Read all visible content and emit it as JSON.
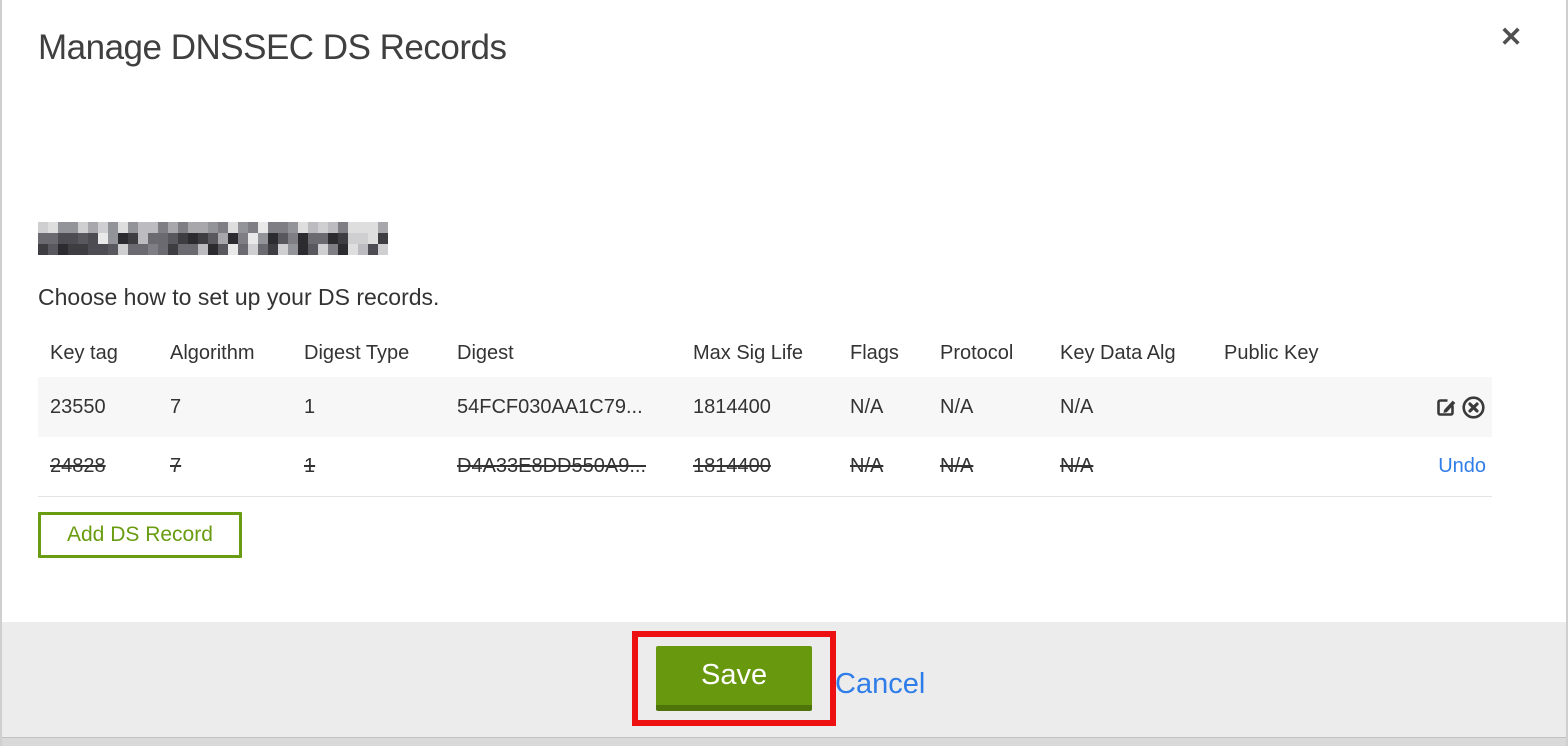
{
  "dialog": {
    "title": "Manage DNSSEC DS Records",
    "close_icon": "close-icon",
    "close_glyph": "✕",
    "instruction": "Choose how to set up your DS records.",
    "table": {
      "columns": [
        "Key tag",
        "Algorithm",
        "Digest Type",
        "Digest",
        "Max Sig Life",
        "Flags",
        "Protocol",
        "Key Data Alg",
        "Public Key"
      ],
      "rows": [
        {
          "key_tag": "23550",
          "algorithm": "7",
          "digest_type": "1",
          "digest": "54FCF030AA1C79...",
          "max_sig_life": "1814400",
          "flags": "N/A",
          "protocol": "N/A",
          "key_data_alg": "N/A",
          "public_key": "",
          "state": "normal",
          "actions": [
            "edit-icon",
            "delete-icon"
          ]
        },
        {
          "key_tag": "24828",
          "algorithm": "7",
          "digest_type": "1",
          "digest": "D4A33E8DD550A9...",
          "max_sig_life": "1814400",
          "flags": "N/A",
          "protocol": "N/A",
          "key_data_alg": "N/A",
          "public_key": "",
          "state": "deleted",
          "undo_label": "Undo"
        }
      ]
    },
    "add_button_label": "Add DS Record",
    "footer": {
      "save_label": "Save",
      "cancel_label": "Cancel"
    }
  },
  "annotations": {
    "save_highlight_color": "#ee1111"
  },
  "colors": {
    "accent_green": "#67980d",
    "accent_green_dark": "#4f750a",
    "outline_green": "#699c10",
    "link_blue": "#2f7de8",
    "footer_gray": "#ececec",
    "row_stripe": "#f7f7f7",
    "text": "#333333"
  }
}
